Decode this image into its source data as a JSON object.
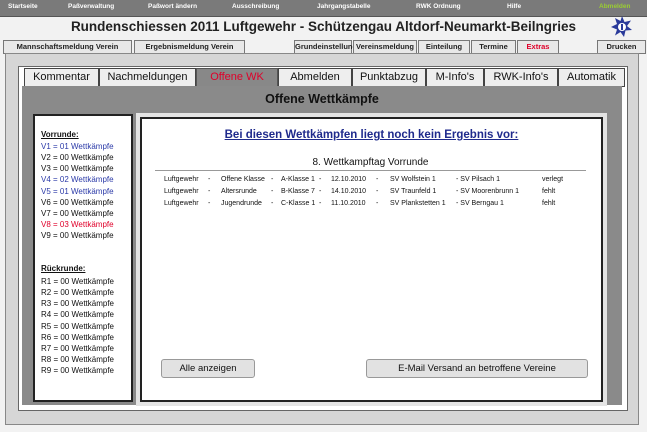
{
  "nav": [
    "Startseite",
    "Paßverwaltung",
    "Paßwort ändern",
    "Ausschreibung",
    "Jahrgangstabelle",
    "RWK Ordnung",
    "Hilfe",
    "Abmelden"
  ],
  "title": "Rundenschiessen 2011 Luftgewehr  -  Schützengau Altdorf-Neumarkt-Beilngries",
  "tabs_left": [
    "Mannschaftsmeldung Verein",
    "Ergebnismeldung Verein"
  ],
  "tabs_right": [
    "Grundeinstellung",
    "Vereinsmeldung",
    "Einteilung",
    "Termine",
    "Extras",
    "Drucken"
  ],
  "subtabs": [
    "Kommentar",
    "Nachmeldungen",
    "Offene WK",
    "Abmelden",
    "Punktabzug",
    "M-Info's",
    "RWK-Info's",
    "Automatik"
  ],
  "section_title": "Offene Wettkämpfe",
  "vorrunde_label": "Vorrunde:",
  "vorrunde": [
    {
      "text": "V1 = 01 Wettkämpfe",
      "color": "#2b3aa8"
    },
    {
      "text": "V2 = 00 Wettkämpfe",
      "color": "#111111"
    },
    {
      "text": "V3 = 00 Wettkämpfe",
      "color": "#111111"
    },
    {
      "text": "V4 = 02 Wettkämpfe",
      "color": "#2b3aa8"
    },
    {
      "text": "V5 = 01 Wettkämpfe",
      "color": "#2b3aa8"
    },
    {
      "text": "V6 = 00 Wettkämpfe",
      "color": "#111111"
    },
    {
      "text": "V7 = 00 Wettkämpfe",
      "color": "#111111"
    },
    {
      "text": "V8 = 03 Wettkämpfe",
      "color": "#e0002a"
    },
    {
      "text": "V9 = 00 Wettkämpfe",
      "color": "#111111"
    }
  ],
  "rueckrunde_label": "Rückrunde:",
  "rueckrunde": [
    "R1 = 00 Wettkämpfe",
    "R2 = 00 Wettkämpfe",
    "R3 = 00 Wettkämpfe",
    "R4 = 00 Wettkämpfe",
    "R5 = 00 Wettkämpfe",
    "R6 = 00 Wettkämpfe",
    "R7 = 00 Wettkämpfe",
    "R8 = 00 Wettkämpfe",
    "R9 = 00 Wettkämpfe"
  ],
  "heading": "Bei diesen Wettkämpfen liegt noch kein Ergebnis vor:",
  "subheading": "8. Wettkampftag Vorrunde",
  "rows": [
    [
      "Luftgewehr",
      "-",
      "Offene Klasse",
      "-",
      "A-Klasse 1",
      "-",
      "12.10.2010",
      "-",
      "SV Wolfstein 1",
      "- SV Pilsach 1",
      "verlegt"
    ],
    [
      "Luftgewehr",
      "-",
      "Altersrunde",
      "-",
      "B-Klasse 7",
      "-",
      "14.10.2010",
      "-",
      "SV Traunfeld 1",
      "- SV Moorenbrunn 1",
      "fehlt"
    ],
    [
      "Luftgewehr",
      "-",
      "Jugendrunde",
      "-",
      "C-Klasse 1",
      "-",
      "11.10.2010",
      "-",
      "SV Plankstetten 1",
      "- SV Berngau 1",
      "fehlt"
    ]
  ],
  "btn_all": "Alle anzeigen",
  "btn_mail": "E-Mail Versand an betroffene Vereine"
}
